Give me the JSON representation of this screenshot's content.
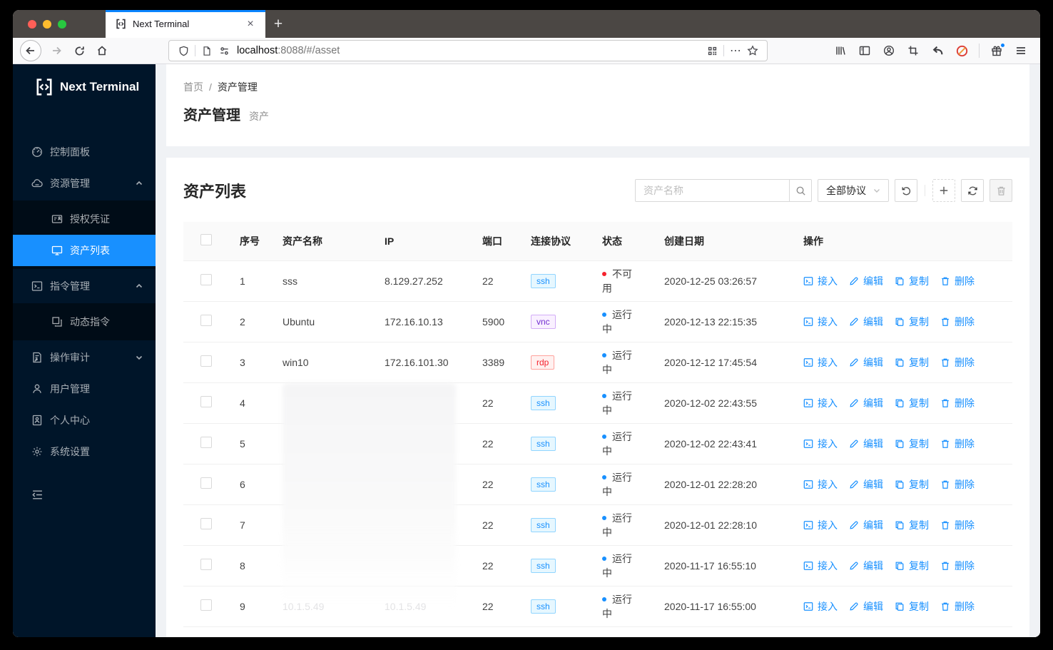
{
  "browser": {
    "tab_title": "Next Terminal",
    "url": {
      "host": "localhost",
      "rest": ":8088/#/asset"
    }
  },
  "sidebar": {
    "logo": "Next Terminal",
    "menu": [
      {
        "label": "控制面板",
        "icon": "dashboard-icon"
      },
      {
        "label": "资源管理",
        "icon": "cloud-icon",
        "expanded": true
      },
      {
        "label": "授权凭证",
        "icon": "idcard-icon"
      },
      {
        "label": "资产列表",
        "icon": "desktop-icon",
        "selected": true
      },
      {
        "label": "指令管理",
        "icon": "code-icon",
        "expanded": true
      },
      {
        "label": "动态指令",
        "icon": "block-icon"
      },
      {
        "label": "操作审计",
        "icon": "audit-icon",
        "expanded": false
      },
      {
        "label": "用户管理",
        "icon": "user-icon"
      },
      {
        "label": "个人中心",
        "icon": "profile-icon"
      },
      {
        "label": "系统设置",
        "icon": "setting-icon"
      }
    ]
  },
  "breadcrumb": {
    "home": "首页",
    "separator": "/",
    "current": "资产管理"
  },
  "header": {
    "title": "资产管理",
    "subtitle": "资产"
  },
  "card": {
    "title": "资产列表"
  },
  "toolbar": {
    "search_placeholder": "资产名称",
    "protocol_filter": "全部协议"
  },
  "table": {
    "columns": [
      "序号",
      "资产名称",
      "IP",
      "端口",
      "连接协议",
      "状态",
      "创建日期",
      "操作"
    ],
    "action_labels": [
      "接入",
      "编辑",
      "复制",
      "删除"
    ],
    "rows": [
      {
        "no": "1",
        "name": "sss",
        "ip": "8.129.27.252",
        "port": "22",
        "protocol": "ssh",
        "status": "不可用",
        "status_type": "error",
        "created": "2020-12-25 03:26:57"
      },
      {
        "no": "2",
        "name": "Ubuntu",
        "ip": "172.16.10.13",
        "port": "5900",
        "protocol": "vnc",
        "status": "运行中",
        "status_type": "processing",
        "created": "2020-12-13 22:15:35"
      },
      {
        "no": "3",
        "name": "win10",
        "ip": "172.16.101.30",
        "port": "3389",
        "protocol": "rdp",
        "status": "运行中",
        "status_type": "processing",
        "created": "2020-12-12 17:45:54"
      },
      {
        "no": "4",
        "name": "",
        "ip": "",
        "masked": true,
        "port": "22",
        "protocol": "ssh",
        "status": "运行中",
        "status_type": "processing",
        "created": "2020-12-02 22:43:55"
      },
      {
        "no": "5",
        "name": "",
        "ip": "",
        "masked": true,
        "port": "22",
        "protocol": "ssh",
        "status": "运行中",
        "status_type": "processing",
        "created": "2020-12-02 22:43:41"
      },
      {
        "no": "6",
        "name": "",
        "ip": "",
        "masked": true,
        "port": "22",
        "protocol": "ssh",
        "status": "运行中",
        "status_type": "processing",
        "created": "2020-12-01 22:28:20"
      },
      {
        "no": "7",
        "name": "",
        "ip": "",
        "masked": true,
        "port": "22",
        "protocol": "ssh",
        "status": "运行中",
        "status_type": "processing",
        "created": "2020-12-01 22:28:10"
      },
      {
        "no": "8",
        "name": "",
        "ip": "",
        "masked": true,
        "port": "22",
        "protocol": "ssh",
        "status": "运行中",
        "status_type": "processing",
        "created": "2020-11-17 16:55:10"
      },
      {
        "no": "9",
        "name": "10.1.5.49",
        "ip": "10.1.5.49",
        "faint": true,
        "port": "22",
        "protocol": "ssh",
        "status": "运行中",
        "status_type": "processing",
        "created": "2020-11-17 16:55:00"
      }
    ]
  },
  "colors": {
    "accent": "#1890ff",
    "sidebar_bg": "#001529",
    "submenu_bg": "#000c17",
    "selected_item": "#1890ff",
    "status_running": "#1890ff",
    "status_unavailable": "#f5222d",
    "tag_ssh": "#1890ff",
    "tag_vnc": "#722ed1",
    "tag_rdp": "#f5222d",
    "tab_accent": "#0a84ff"
  }
}
